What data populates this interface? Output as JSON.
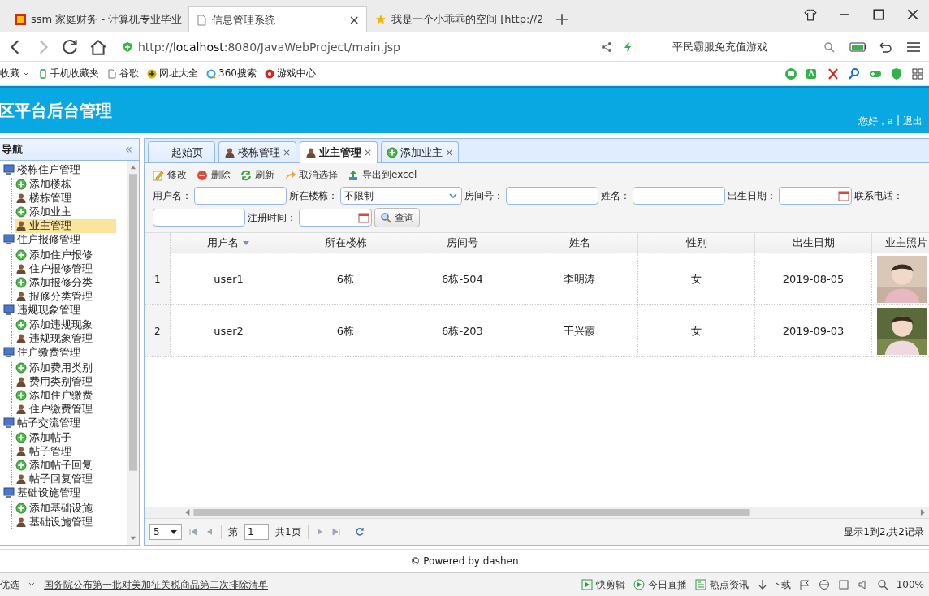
{
  "browser": {
    "tabs": [
      {
        "title": "ssm 家庭财务 - 计算机专业毕业",
        "selected": false,
        "closable": false
      },
      {
        "title": "信息管理系统",
        "selected": true,
        "closable": true
      },
      {
        "title": "我是一个小乖乖的空间 [http://2",
        "selected": false,
        "closable": false
      }
    ],
    "address": {
      "scheme": "http://",
      "host": "localhost",
      "rest": ":8080/JavaWebProject/main.jsp"
    },
    "search_placeholder": "平民霸服免充值游戏",
    "bookmarks": [
      {
        "label": "收藏",
        "kind": "menu"
      },
      {
        "label": "手机收藏夹",
        "kind": "phone"
      },
      {
        "label": "谷歌",
        "kind": "page"
      },
      {
        "label": "网址大全",
        "kind": "plus"
      },
      {
        "label": "360搜索",
        "kind": "search"
      },
      {
        "label": "游戏中心",
        "kind": "game"
      }
    ]
  },
  "header": {
    "title": "区平台后台管理",
    "greeting": "您好，a",
    "separator": "|",
    "logout": "退出"
  },
  "sidebar": {
    "title": "导航",
    "collapse": "«",
    "items": [
      {
        "label": "楼栋住户管理",
        "kind": "group",
        "selected": false,
        "children": [
          {
            "label": "添加楼栋",
            "kind": "add",
            "selected": false
          },
          {
            "label": "楼栋管理",
            "kind": "manage",
            "selected": false
          },
          {
            "label": "添加业主",
            "kind": "add",
            "selected": false
          },
          {
            "label": "业主管理",
            "kind": "manage",
            "selected": true
          }
        ]
      },
      {
        "label": "住户报修管理",
        "kind": "group",
        "selected": false,
        "children": [
          {
            "label": "添加住户报修",
            "kind": "add",
            "selected": false
          },
          {
            "label": "住户报修管理",
            "kind": "manage",
            "selected": false
          },
          {
            "label": "添加报修分类",
            "kind": "add",
            "selected": false
          },
          {
            "label": "报修分类管理",
            "kind": "manage",
            "selected": false
          }
        ]
      },
      {
        "label": "违规现象管理",
        "kind": "group",
        "selected": false,
        "children": [
          {
            "label": "添加违规现象",
            "kind": "add",
            "selected": false
          },
          {
            "label": "违规现象管理",
            "kind": "manage",
            "selected": false
          }
        ]
      },
      {
        "label": "住户缴费管理",
        "kind": "group",
        "selected": false,
        "children": [
          {
            "label": "添加费用类别",
            "kind": "add",
            "selected": false
          },
          {
            "label": "费用类别管理",
            "kind": "manage",
            "selected": false
          },
          {
            "label": "添加住户缴费",
            "kind": "add",
            "selected": false
          },
          {
            "label": "住户缴费管理",
            "kind": "manage",
            "selected": false
          }
        ]
      },
      {
        "label": "帖子交流管理",
        "kind": "group",
        "selected": false,
        "children": [
          {
            "label": "添加帖子",
            "kind": "add",
            "selected": false
          },
          {
            "label": "帖子管理",
            "kind": "manage",
            "selected": false
          },
          {
            "label": "添加帖子回复",
            "kind": "add",
            "selected": false
          },
          {
            "label": "帖子回复管理",
            "kind": "manage",
            "selected": false
          }
        ]
      },
      {
        "label": "基础设施管理",
        "kind": "group",
        "selected": false,
        "children": [
          {
            "label": "添加基础设施",
            "kind": "add",
            "selected": false
          },
          {
            "label": "基础设施管理",
            "kind": "manage",
            "selected": false
          }
        ]
      }
    ]
  },
  "tabs": [
    {
      "label": "起始页",
      "kind": "home",
      "selected": false,
      "closable": false
    },
    {
      "label": "楼栋管理",
      "kind": "manage",
      "selected": false,
      "closable": true
    },
    {
      "label": "业主管理",
      "kind": "manage",
      "selected": true,
      "closable": true
    },
    {
      "label": "添加业主",
      "kind": "add",
      "selected": false,
      "closable": true
    }
  ],
  "close_mark": "×",
  "toolbar": [
    {
      "label": "修改",
      "kind": "edit"
    },
    {
      "label": "删除",
      "kind": "delete"
    },
    {
      "label": "刷新",
      "kind": "refresh"
    },
    {
      "label": "取消选择",
      "kind": "undo"
    },
    {
      "label": "导出到excel",
      "kind": "export"
    }
  ],
  "search": {
    "fields": [
      {
        "label": "用户名：",
        "kind": "text"
      },
      {
        "label": "所在楼栋：",
        "kind": "select",
        "value": "不限制"
      },
      {
        "label": "房间号：",
        "kind": "text"
      },
      {
        "label": "姓名：",
        "kind": "text"
      },
      {
        "label": "出生日期：",
        "kind": "date"
      },
      {
        "label": "联系电话：",
        "kind": "text"
      },
      {
        "label": "注册时间：",
        "kind": "date"
      }
    ],
    "button": "查询"
  },
  "grid": {
    "columns": [
      {
        "label": "用户名",
        "sorted": true
      },
      {
        "label": "所在楼栋",
        "sorted": false
      },
      {
        "label": "房间号",
        "sorted": false
      },
      {
        "label": "姓名",
        "sorted": false
      },
      {
        "label": "性别",
        "sorted": false
      },
      {
        "label": "出生日期",
        "sorted": false
      },
      {
        "label": "业主照片",
        "sorted": false
      }
    ],
    "rows": [
      {
        "number": "1",
        "cells": [
          "user1",
          "6栋",
          "6栋-504",
          "李明涛",
          "女",
          "2019-08-05"
        ],
        "photo": {
          "kind": "picture"
        }
      },
      {
        "number": "2",
        "cells": [
          "user2",
          "6栋",
          "6栋-203",
          "王兴霞",
          "女",
          "2019-09-03"
        ],
        "photo": {
          "kind": "picture"
        }
      }
    ]
  },
  "pager": {
    "page_size": "5",
    "page_label": "第",
    "page": "1",
    "total_pages": "共1页",
    "summary": "显示1到2,共2记录"
  },
  "footer": "© Powered by dashen",
  "status_bar": {
    "left": "优选",
    "news": "国务院公布第一批对美加征关税商品第二次排除清单",
    "items": [
      {
        "label": "快剪辑",
        "kind": "play"
      },
      {
        "label": "今日直播",
        "kind": "live"
      },
      {
        "label": "热点资讯",
        "kind": "news"
      },
      {
        "label": "下载",
        "kind": "download"
      }
    ],
    "zoom": "100%"
  }
}
